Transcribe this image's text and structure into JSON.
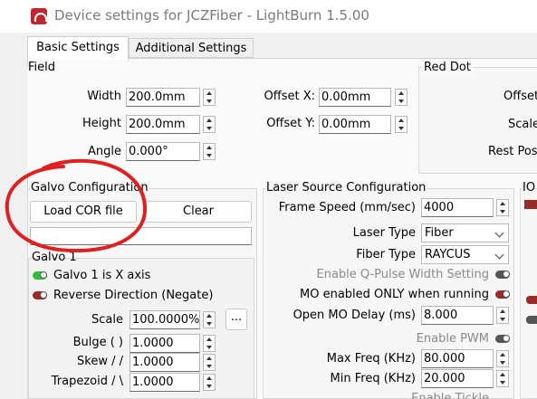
{
  "window": {
    "title": "Device settings for JCZFiber - LightBurn 1.5.00"
  },
  "tabs": [
    {
      "label": "Basic Settings",
      "active": true
    },
    {
      "label": "Additional Settings",
      "active": false
    }
  ],
  "field": {
    "label": "Field",
    "width_label": "Width",
    "width_value": "200.0mm",
    "height_label": "Height",
    "height_value": "200.0mm",
    "angle_label": "Angle",
    "angle_value": "0.000°",
    "offset_x_label": "Offset X:",
    "offset_x_value": "0.00mm",
    "offset_y_label": "Offset Y:",
    "offset_y_value": "0.00mm"
  },
  "red_dot": {
    "label": "Red Dot",
    "offset_label": "Offset",
    "scale_label": "Scale",
    "rest_pos_label": "Rest Pos"
  },
  "galvo_config": {
    "label": "Galvo Configuration",
    "load_cor_label": "Load COR file",
    "clear_label": "Clear",
    "cor_path": "",
    "galvo1": {
      "label": "Galvo 1",
      "x_axis_label": "Galvo 1 is X axis",
      "x_axis_on": true,
      "reverse_label": "Reverse Direction (Negate)",
      "reverse_on": false,
      "scale_label": "Scale",
      "scale_value": "100.0000%",
      "more_label": "...",
      "bulge_label": "Bulge ( )",
      "bulge_value": "1.0000",
      "skew_label": "Skew / /",
      "skew_value": "1.0000",
      "trapezoid_label": "Trapezoid / \\",
      "trapezoid_value": "1.0000"
    }
  },
  "laser_source": {
    "label": "Laser Source Configuration",
    "frame_speed_label": "Frame Speed (mm/sec)",
    "frame_speed_value": "4000",
    "laser_type_label": "Laser Type",
    "laser_type_value": "Fiber",
    "fiber_type_label": "Fiber Type",
    "fiber_type_value": "RAYCUS",
    "qpulse_label": "Enable Q-Pulse Width Setting",
    "mo_enabled_label": "MO enabled ONLY when running",
    "open_mo_delay_label": "Open MO Delay (ms)",
    "open_mo_delay_value": "8.000",
    "enable_pwm_label": "Enable PWM",
    "max_freq_label": "Max Freq (KHz)",
    "max_freq_value": "80.000",
    "min_freq_label": "Min Freq (KHz)",
    "min_freq_value": "20.000",
    "cut_off_label": "Enable Tickle"
  },
  "io": {
    "label": "IO"
  },
  "colors": {
    "annotation": "#e02020",
    "toggle_on": "#2fbf3b",
    "toggle_off": "#9b2a2a",
    "accent": "#c0272d"
  },
  "icons": [
    "app-logo-icon",
    "spin-arrows-icon",
    "chevron-down-icon",
    "toggle-icon"
  ]
}
